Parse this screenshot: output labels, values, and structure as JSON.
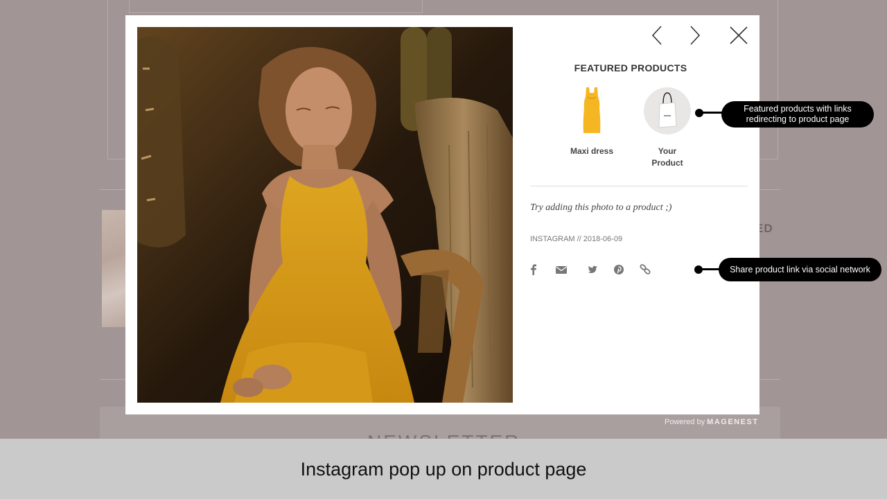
{
  "background": {
    "partial_heading": "ED",
    "newsletter_heading": "NEWSLETTER",
    "powered_prefix": "Powered by",
    "powered_brand": "MAGENEST"
  },
  "popup": {
    "nav": {
      "prev_icon": "chevron-left-icon",
      "next_icon": "chevron-right-icon",
      "close_icon": "close-icon"
    },
    "featured_title": "FEATURED PRODUCTS",
    "products": [
      {
        "name": "Maxi dress",
        "icon": "yellow-dress-thumbnail"
      },
      {
        "name": "Your Product",
        "icon": "shopping-bag-thumbnail"
      }
    ],
    "caption": "Try adding this photo to a product ;)",
    "meta": "INSTAGRAM // 2018-06-09",
    "share": [
      {
        "network": "facebook",
        "icon": "facebook-icon"
      },
      {
        "network": "email",
        "icon": "envelope-icon"
      },
      {
        "network": "twitter",
        "icon": "twitter-icon"
      },
      {
        "network": "pinterest",
        "icon": "pinterest-icon"
      },
      {
        "network": "link",
        "icon": "link-icon"
      }
    ]
  },
  "callouts": [
    {
      "line1": "Featured products with links",
      "line2": "redirecting to product page"
    },
    {
      "text": "Share product link via social network"
    }
  ],
  "footer_caption": "Instagram pop up on product page",
  "colors": {
    "overlay": "#a29595",
    "modal_bg": "#ffffff",
    "dress_yellow": "#f5b623",
    "callout_bg": "#000000",
    "caption_bar": "#cbcaca"
  }
}
